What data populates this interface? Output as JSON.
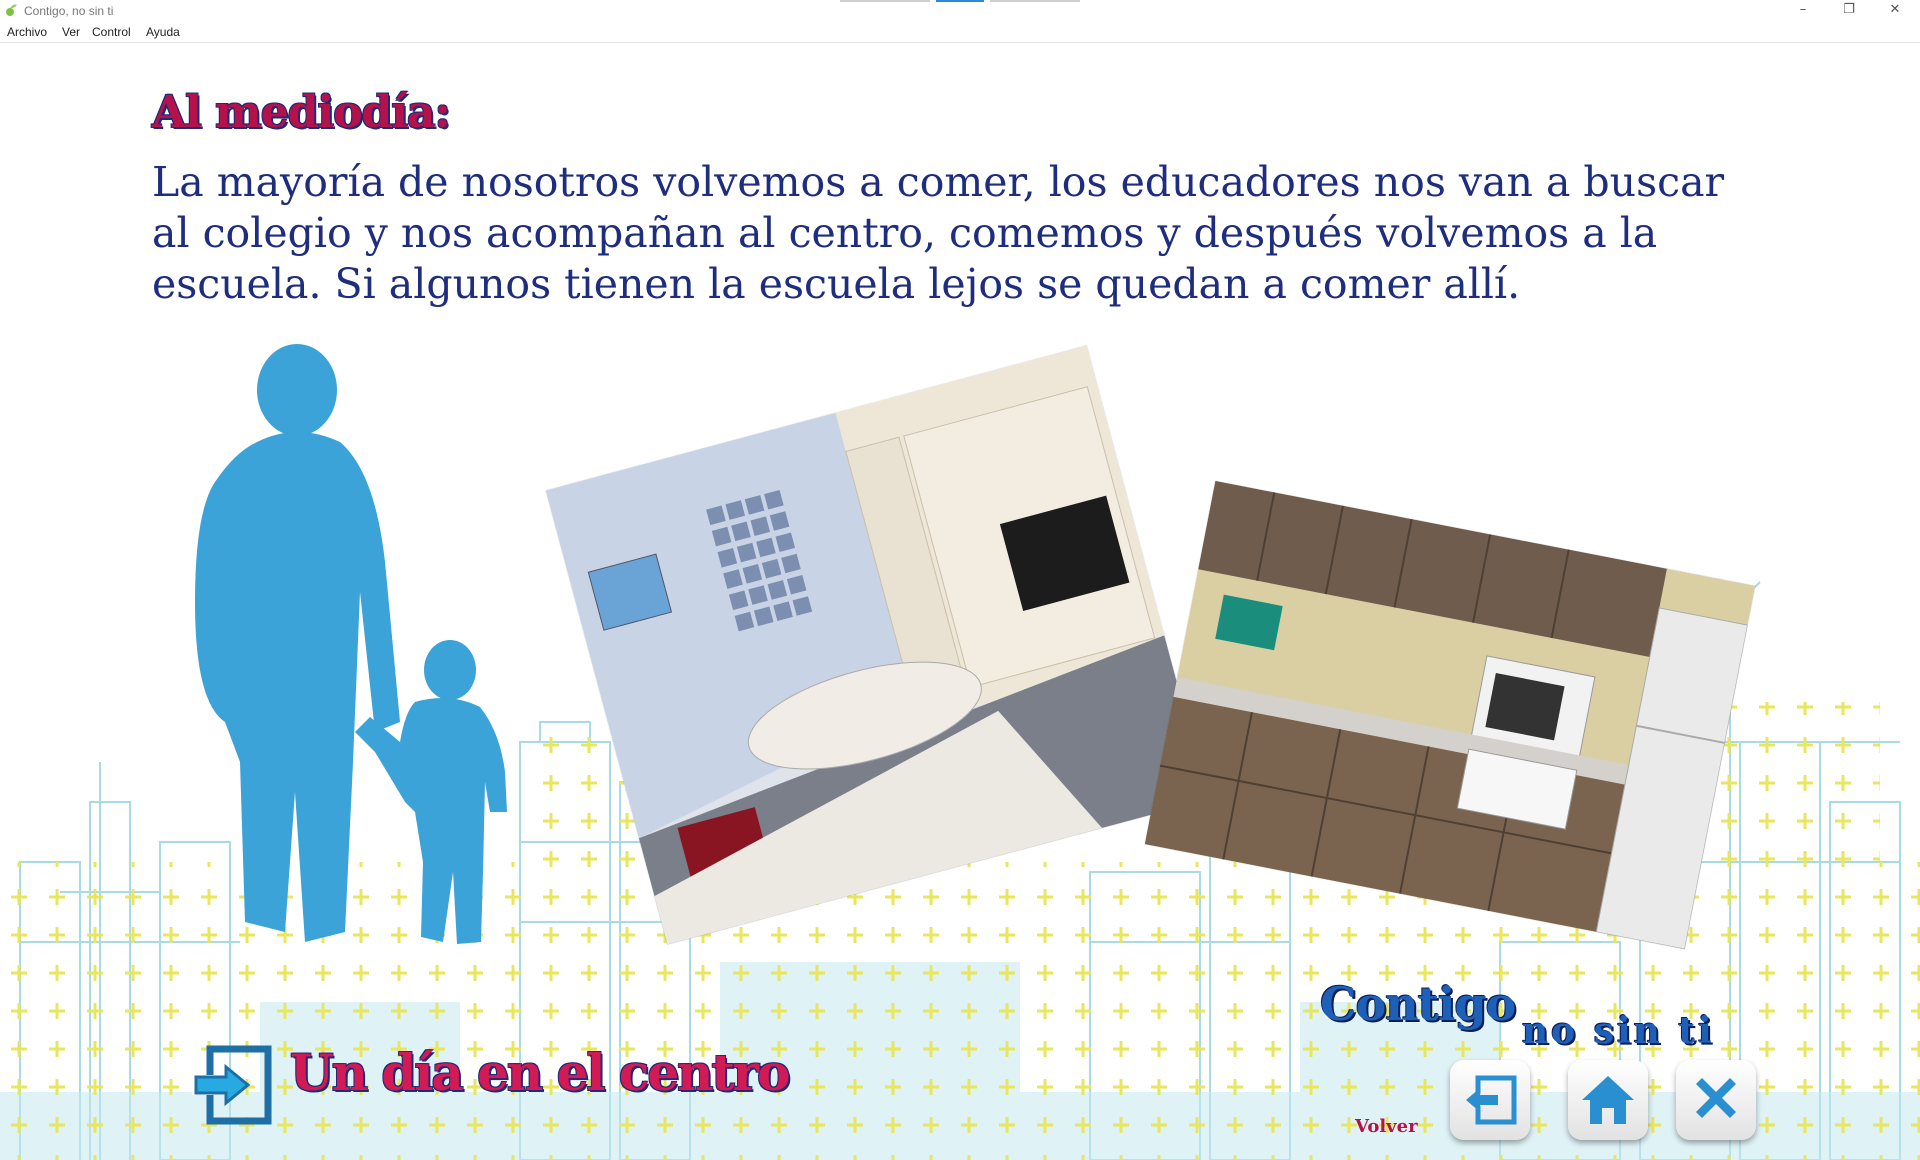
{
  "window": {
    "title": "Contigo, no sin ti",
    "minimize": "–",
    "restore": "❐",
    "close": "✕"
  },
  "menu": [
    "Archivo",
    "Ver",
    "Control",
    "Ayuda"
  ],
  "page": {
    "heading": "Al mediodía:",
    "body": "La mayoría de nosotros volvemos a comer, los educadores nos van a buscar al colegio y nos acompañan al centro, comemos y después volvemos a la escuela. Si algunos tienen la escuela lejos se quedan a comer allí.",
    "section_title": "Un día en el centro"
  },
  "brand": {
    "line1": "Contigo",
    "line2": "no sin ti"
  },
  "nav": {
    "volver_label": "Volver",
    "back_icon": "exit-arrow-icon",
    "home_icon": "home-icon",
    "close_icon": "close-x-icon"
  },
  "colors": {
    "heading": "#b5124b",
    "text": "#1e2d7e",
    "silhouette": "#3ba3d8",
    "brand": "#1e5fb8",
    "button_icon": "#2a8fd0"
  }
}
